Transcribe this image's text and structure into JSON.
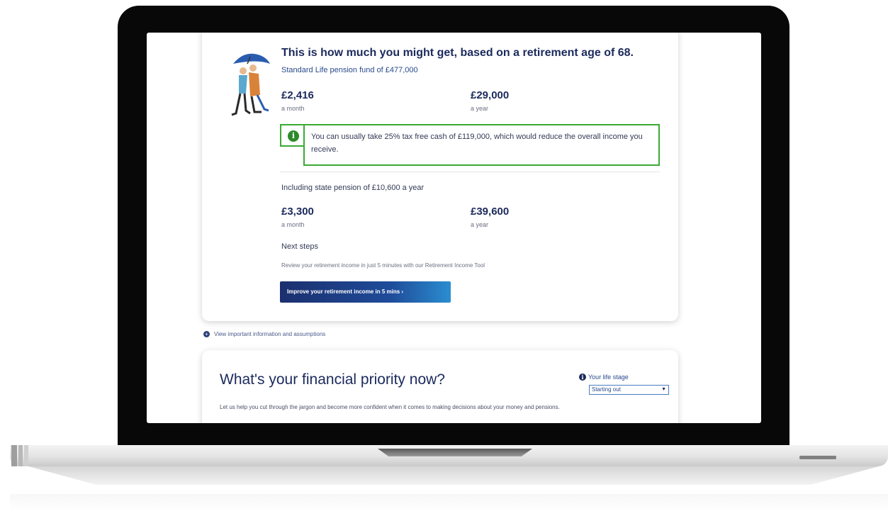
{
  "result": {
    "headline": "This is how much you might get, based on a retirement age of 68.",
    "fund_line": "Standard Life pension fund of £477,000",
    "monthly_amount": "£2,416",
    "monthly_period": "a month",
    "yearly_amount": "£29,000",
    "yearly_period": "a year",
    "info_icon_glyph": "i",
    "info_text": "You can usually take 25% tax free cash of £119,000, which would reduce the overall income you receive.",
    "state_pension_line": "Including state pension of £10,600 a year",
    "state_monthly_amount": "£3,300",
    "state_monthly_period": "a month",
    "state_yearly_amount": "£39,600",
    "state_yearly_period": "a year"
  },
  "next_steps": {
    "title": "Next steps",
    "description": "Review your retirement income in just 5 minutes with our Retirement Income Tool",
    "button_label": "Improve your retirement income in 5 mins  ›"
  },
  "assumptions": {
    "icon_glyph": "+",
    "label": "View important information and assumptions"
  },
  "priority": {
    "title": "What's your financial priority now?",
    "life_stage_icon_glyph": "i",
    "life_stage_label": "Your life stage",
    "life_stage_selected": "Starting out",
    "description": "Let us help you cut through the jargon and become more confident when it comes to making decisions about your money and pensions."
  },
  "colors": {
    "navy": "#1b2a5c",
    "info_border": "#3aaa35",
    "cta_start": "#1b2f6e",
    "cta_end": "#2b8dd0"
  }
}
